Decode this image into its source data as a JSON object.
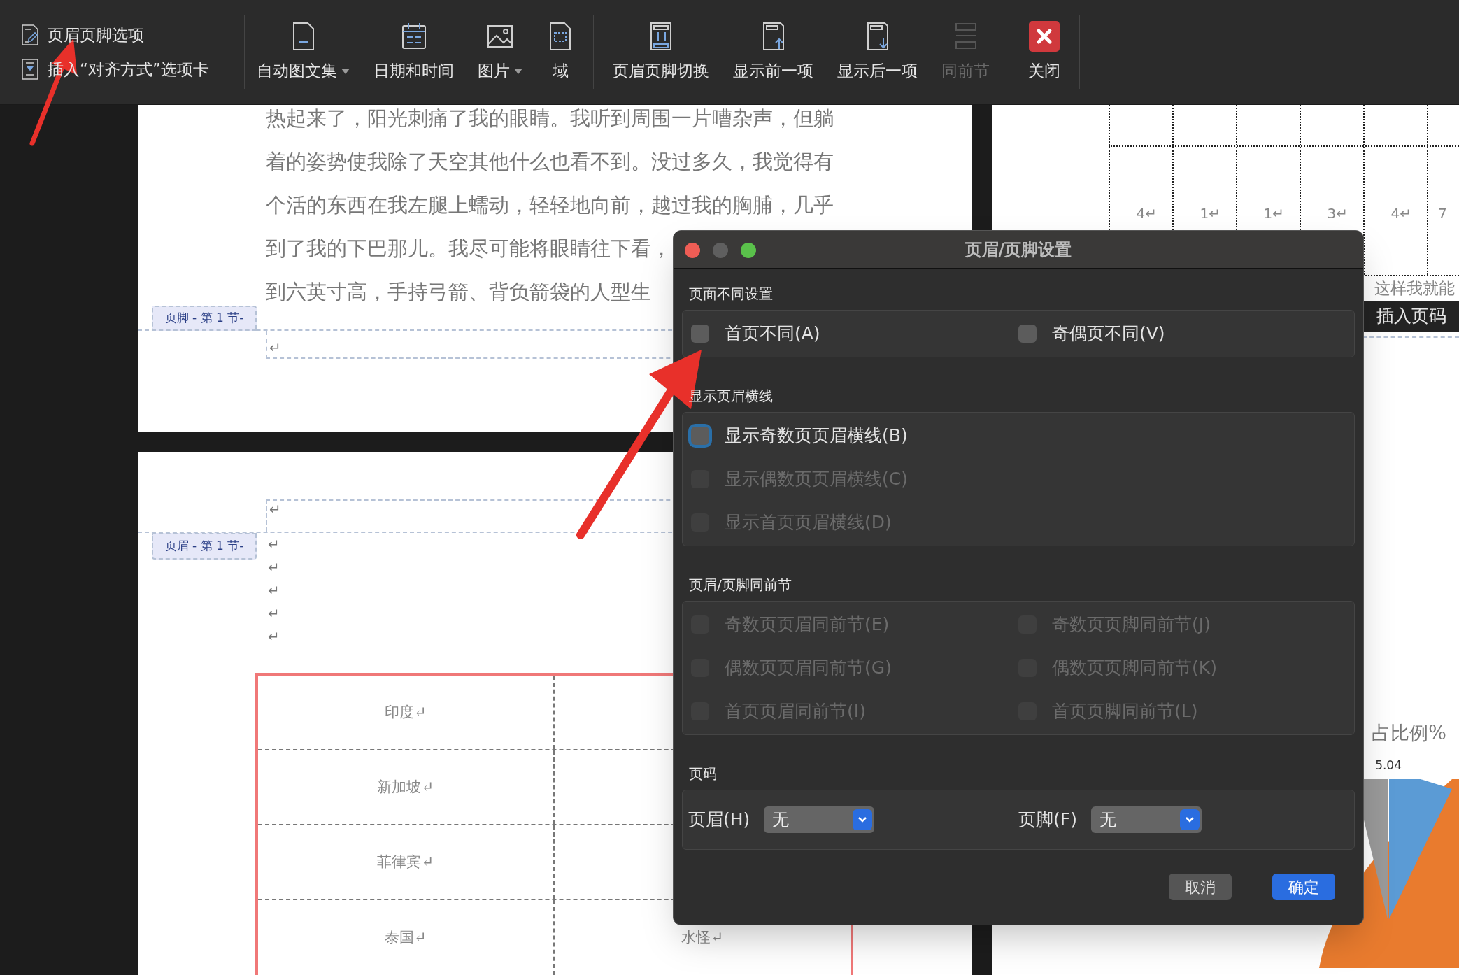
{
  "toolbar": {
    "options": [
      {
        "label": "页眉页脚选项",
        "kind": "options"
      },
      {
        "label": "插入“对齐方式”选项卡",
        "kind": "align"
      }
    ],
    "buttons": [
      {
        "label": "自动图文集",
        "kind": "autotext",
        "dropdown": true,
        "disabled": false
      },
      {
        "label": "日期和时间",
        "kind": "datetime",
        "dropdown": false,
        "disabled": false
      },
      {
        "label": "图片",
        "kind": "picture",
        "dropdown": true,
        "disabled": false
      },
      {
        "label": "域",
        "kind": "field",
        "dropdown": false,
        "disabled": false
      },
      {
        "label": "页眉页脚切换",
        "kind": "switch",
        "dropdown": false,
        "disabled": false
      },
      {
        "label": "显示前一项",
        "kind": "prev",
        "dropdown": false,
        "disabled": false
      },
      {
        "label": "显示后一项",
        "kind": "next",
        "dropdown": false,
        "disabled": false
      },
      {
        "label": "同前节",
        "kind": "same",
        "dropdown": false,
        "disabled": true
      },
      {
        "label": "关闭",
        "kind": "close",
        "dropdown": false,
        "disabled": false
      }
    ]
  },
  "left_pages": {
    "body_lines": [
      "热起来了，阳光刺痛了我的眼睛。我听到周围一片嘈杂声，但躺",
      "着的姿势使我除了天空其他什么也看不到。没过多久，我觉得有",
      "个活的东西在我左腿上蠕动，轻轻地向前，越过我的胸脯，几乎",
      "到了我的下巴那儿。我尽可能将眼睛往下看，",
      "到六英寸高，手持弓箭、背负箭袋的人型生"
    ],
    "footer_tag": "页脚 - 第 1 节-",
    "footer_mark": "↵",
    "header_mark": "↵",
    "header_tag": "页眉 - 第 1 节-",
    "paragraph_marks": [
      "↵",
      "↵",
      "↵",
      "↵",
      "↵"
    ],
    "table_rows": [
      {
        "cells": [
          "印度↵"
        ]
      },
      {
        "cells": [
          "新加坡↵"
        ]
      },
      {
        "cells": [
          "菲律宾↵"
        ]
      },
      {
        "cells": [
          "泰国↵",
          "水怪↵"
        ]
      }
    ]
  },
  "right_page": {
    "table_cells": [
      "4↵",
      "1↵",
      "1↵",
      "3↵",
      "4↵",
      "7"
    ],
    "text_fragment": "这样我就能",
    "tooltip": "插入页码",
    "chart_title": "占比例%",
    "chart_label": "5.04"
  },
  "dialog": {
    "title": "页眉/页脚设置",
    "sections": [
      {
        "title": "页面不同设置",
        "kind": "pairs",
        "items": [
          {
            "label": "首页不同(A)",
            "checked": false,
            "disabled": false,
            "focused": false
          },
          {
            "label": "奇偶页不同(V)",
            "checked": false,
            "disabled": false,
            "focused": false
          }
        ]
      },
      {
        "title": "显示页眉横线",
        "kind": "list",
        "items": [
          {
            "label": "显示奇数页页眉横线(B)",
            "checked": false,
            "disabled": false,
            "focused": true
          },
          {
            "label": "显示偶数页页眉横线(C)",
            "checked": false,
            "disabled": true,
            "focused": false
          },
          {
            "label": "显示首页页眉横线(D)",
            "checked": false,
            "disabled": true,
            "focused": false
          }
        ]
      },
      {
        "title": "页眉/页脚同前节",
        "kind": "pairs",
        "items": [
          {
            "label": "奇数页页眉同前节(E)",
            "checked": false,
            "disabled": true,
            "focused": false
          },
          {
            "label": "奇数页页脚同前节(J)",
            "checked": false,
            "disabled": true,
            "focused": false
          },
          {
            "label": "偶数页页眉同前节(G)",
            "checked": false,
            "disabled": true,
            "focused": false
          },
          {
            "label": "偶数页页脚同前节(K)",
            "checked": false,
            "disabled": true,
            "focused": false
          },
          {
            "label": "首页页眉同前节(I)",
            "checked": false,
            "disabled": true,
            "focused": false
          },
          {
            "label": "首页页脚同前节(L)",
            "checked": false,
            "disabled": true,
            "focused": false
          }
        ]
      }
    ],
    "page_number": {
      "title": "页码",
      "selects": [
        {
          "label": "页眉(H)",
          "value": "无"
        },
        {
          "label": "页脚(F)",
          "value": "无"
        }
      ]
    },
    "buttons": [
      {
        "label": "取消",
        "primary": false
      },
      {
        "label": "确定",
        "primary": true
      }
    ]
  }
}
